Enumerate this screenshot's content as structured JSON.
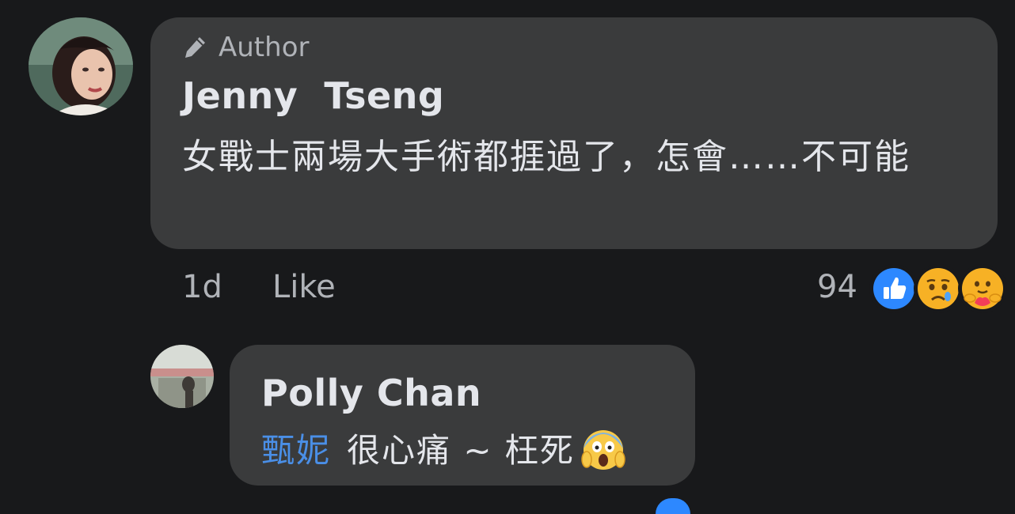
{
  "comment": {
    "author_badge": "Author",
    "author_name": "Jenny  Tseng",
    "text": "女戰士兩場大手術都捱過了，怎會……不可能",
    "time": "1d",
    "like_label": "Like",
    "reaction_count": "94",
    "reactions": [
      "like-icon",
      "sad-icon",
      "care-icon"
    ]
  },
  "reply": {
    "author_name": "Polly Chan",
    "mention": "甄妮",
    "text": "很心痛 ~ 枉死",
    "emoji": "screaming-face-icon"
  },
  "colors": {
    "background": "#18191b",
    "bubble": "#3a3b3c",
    "text": "#e4e6eb",
    "secondary_text": "#b0b3b8",
    "mention": "#4a8fe7",
    "like_blue": "#2d88ff"
  }
}
